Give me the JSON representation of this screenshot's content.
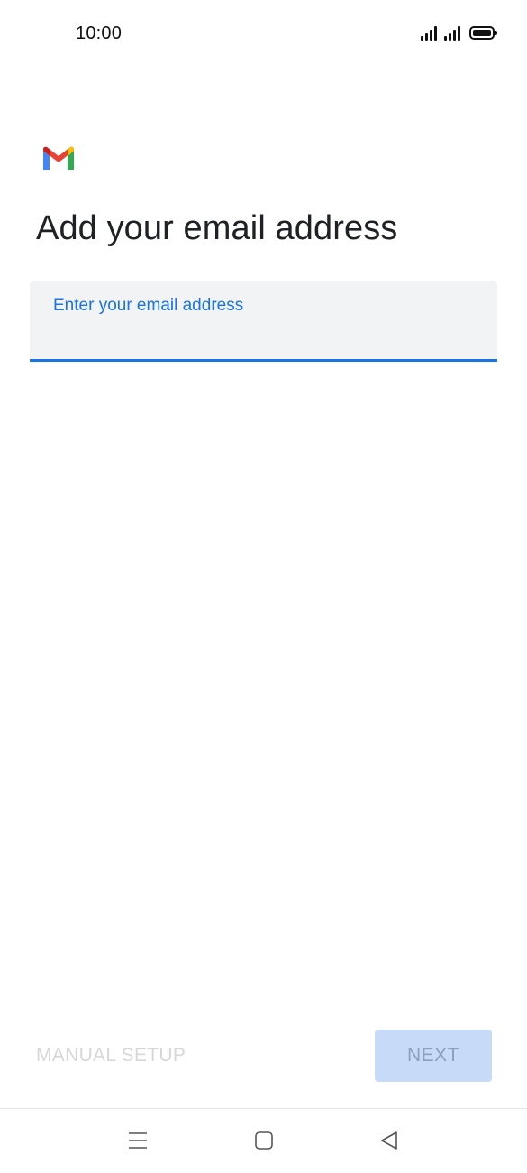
{
  "status_bar": {
    "time": "10:00"
  },
  "brand": {
    "logo_colors": {
      "red": "#ea4335",
      "blue": "#4285f4",
      "green": "#34a853",
      "yellow": "#fbbc04",
      "dark_red": "#c5221f"
    }
  },
  "page": {
    "title": "Add your email address"
  },
  "email_field": {
    "label": "Enter your email address",
    "value": "",
    "accent_color": "#1a73e8"
  },
  "actions": {
    "manual_setup_label": "MANUAL SETUP",
    "next_label": "NEXT"
  },
  "nav_bar": {
    "icons": [
      "menu-icon",
      "home-icon",
      "back-icon"
    ]
  }
}
